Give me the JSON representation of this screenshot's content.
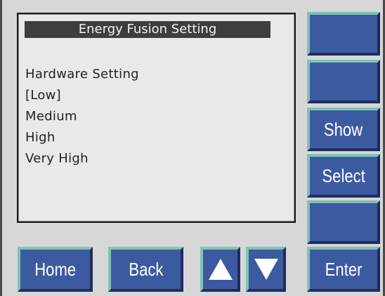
{
  "screen": {
    "title": "Energy Fusion Setting",
    "menu": {
      "heading": "Hardware Setting",
      "options": [
        "[Low]",
        "Medium",
        "High",
        "Very High"
      ]
    }
  },
  "side_buttons": {
    "show_label": "Show",
    "select_label": "Select"
  },
  "bottom_buttons": {
    "home_label": "Home",
    "back_label": "Back",
    "up_icon": "up-arrow-icon",
    "down_icon": "down-arrow-icon",
    "enter_label": "Enter"
  },
  "colors": {
    "button_face": "#3c5aa0",
    "button_highlight": "#7fc3b3",
    "title_bar": "#3e3e3e",
    "panel": "#d7d7d7",
    "screen": "#e9e9e9"
  }
}
